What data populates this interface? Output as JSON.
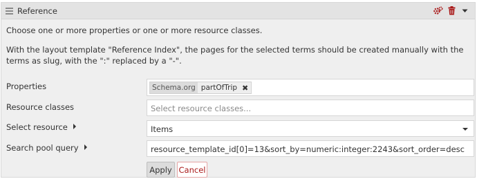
{
  "block": {
    "title": "Reference",
    "accent_color": "#a91919"
  },
  "intro": {
    "line1": "Choose one or more properties or one or more resource classes.",
    "line2": "With the layout template \"Reference Index\", the pages for the selected terms should be created manually with the terms as slug, with the \":\" replaced by a \"-\"."
  },
  "form": {
    "properties": {
      "label": "Properties",
      "selected": [
        {
          "vocab": "Schema.org",
          "term": "partOfTrip",
          "remove_glyph": "✖"
        }
      ]
    },
    "resource_classes": {
      "label": "Resource classes",
      "placeholder": "Select resource classes..."
    },
    "select_resource": {
      "label": "Select resource",
      "value": "Items"
    },
    "search_pool_query": {
      "label": "Search pool query",
      "value": "resource_template_id[0]=13&sort_by=numeric:integer:2243&sort_order=desc"
    }
  },
  "actions": {
    "apply_label": "Apply",
    "cancel_label": "Cancel"
  }
}
